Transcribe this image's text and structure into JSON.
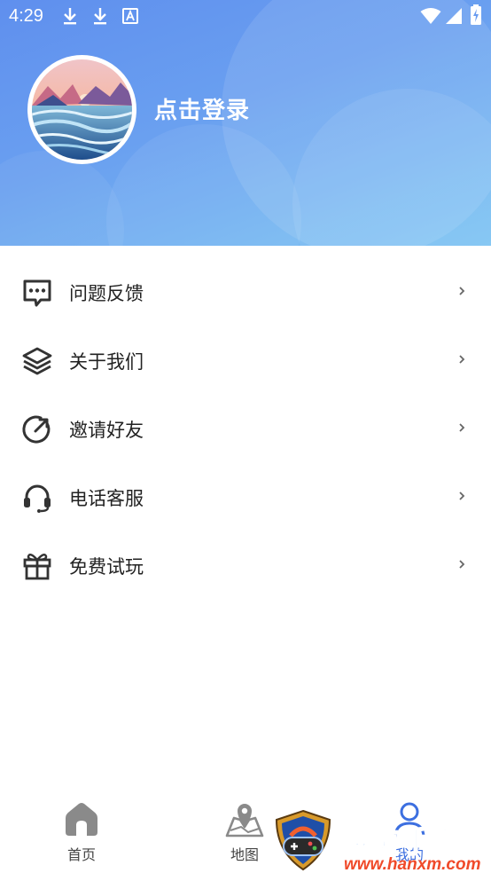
{
  "status_bar": {
    "time": "4:29",
    "left_icons": [
      "download-icon",
      "download-icon",
      "font-icon"
    ],
    "right_icons": [
      "wifi-icon",
      "cellular-signal-icon",
      "battery-charging-icon"
    ]
  },
  "profile": {
    "login_label": "点击登录",
    "avatar": "landscape-sunset-ocean-image"
  },
  "colors": {
    "header_gradient_start": "#5f8fee",
    "header_gradient_end": "#7dc4f2",
    "icon_dark": "#333333",
    "active_tab": "#3c6fe0",
    "inactive_tab": "#8a8a8a"
  },
  "menu": [
    {
      "label": "问题反馈",
      "icon": "message-dots-icon"
    },
    {
      "label": "关于我们",
      "icon": "layers-icon"
    },
    {
      "label": "邀请好友",
      "icon": "share-arrow-icon"
    },
    {
      "label": "电话客服",
      "icon": "headset-icon"
    },
    {
      "label": "免费试玩",
      "icon": "gift-icon"
    }
  ],
  "tabbar": [
    {
      "label": "首页",
      "icon": "home-icon",
      "active": false
    },
    {
      "label": "地图",
      "icon": "map-pin-icon",
      "active": false
    },
    {
      "label": "我的",
      "icon": "user-icon",
      "active": true
    }
  ],
  "watermark": {
    "title": "西美手游网",
    "url": "www.hanxm.com"
  }
}
